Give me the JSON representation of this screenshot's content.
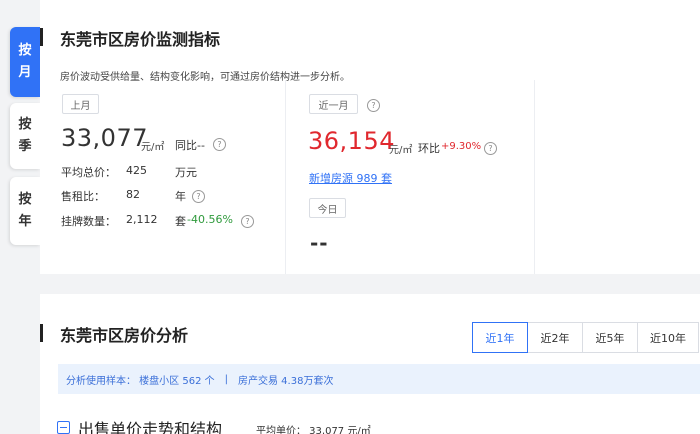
{
  "side_tabs": [
    {
      "chars": [
        "按",
        "月"
      ],
      "active": true
    },
    {
      "chars": [
        "按",
        "季"
      ],
      "active": false
    },
    {
      "chars": [
        "按",
        "年"
      ],
      "active": false
    }
  ],
  "monitor": {
    "title": "东莞市区房价监测指标",
    "subtitle": "房价波动受供给量、结构变化影响，可通过房价结构进一步分析。",
    "last_month": {
      "pill": "上月",
      "price": "33,077",
      "unit": "元/㎡",
      "yoy_label": "同比--",
      "rows": [
        {
          "label": "平均总价：",
          "value": "425",
          "unit": "万元",
          "extra": "",
          "help": false
        },
        {
          "label": "售租比：",
          "value": "82",
          "unit": "年",
          "extra": "",
          "help": true
        },
        {
          "label": "挂牌数量：",
          "value": "2,112",
          "unit": "套",
          "extra": "-40.56%",
          "help": true
        }
      ]
    },
    "recent_month": {
      "pill": "近一月",
      "price": "36,154",
      "unit": "元/㎡",
      "mom_label": "环比",
      "mom_value": "+9.30%",
      "new_listing": "新增房源 989 套",
      "today_pill": "今日",
      "today_value": "--"
    }
  },
  "analysis": {
    "title": "东莞市区房价分析",
    "ranges": [
      "近1年",
      "近2年",
      "近5年",
      "近10年"
    ],
    "active_range": "近1年",
    "notice_sample": "分析使用样本：  楼盘小区 562 个",
    "notice_sep": "|",
    "notice_trade": "房产交易 4.38万套次",
    "section_title": "出售单价走势和结构",
    "avg_price": "平均单价：  33,077 元/㎡"
  },
  "colors": {
    "accent": "#3072f6",
    "up": "#e0282e",
    "down": "#2f9a3c"
  }
}
